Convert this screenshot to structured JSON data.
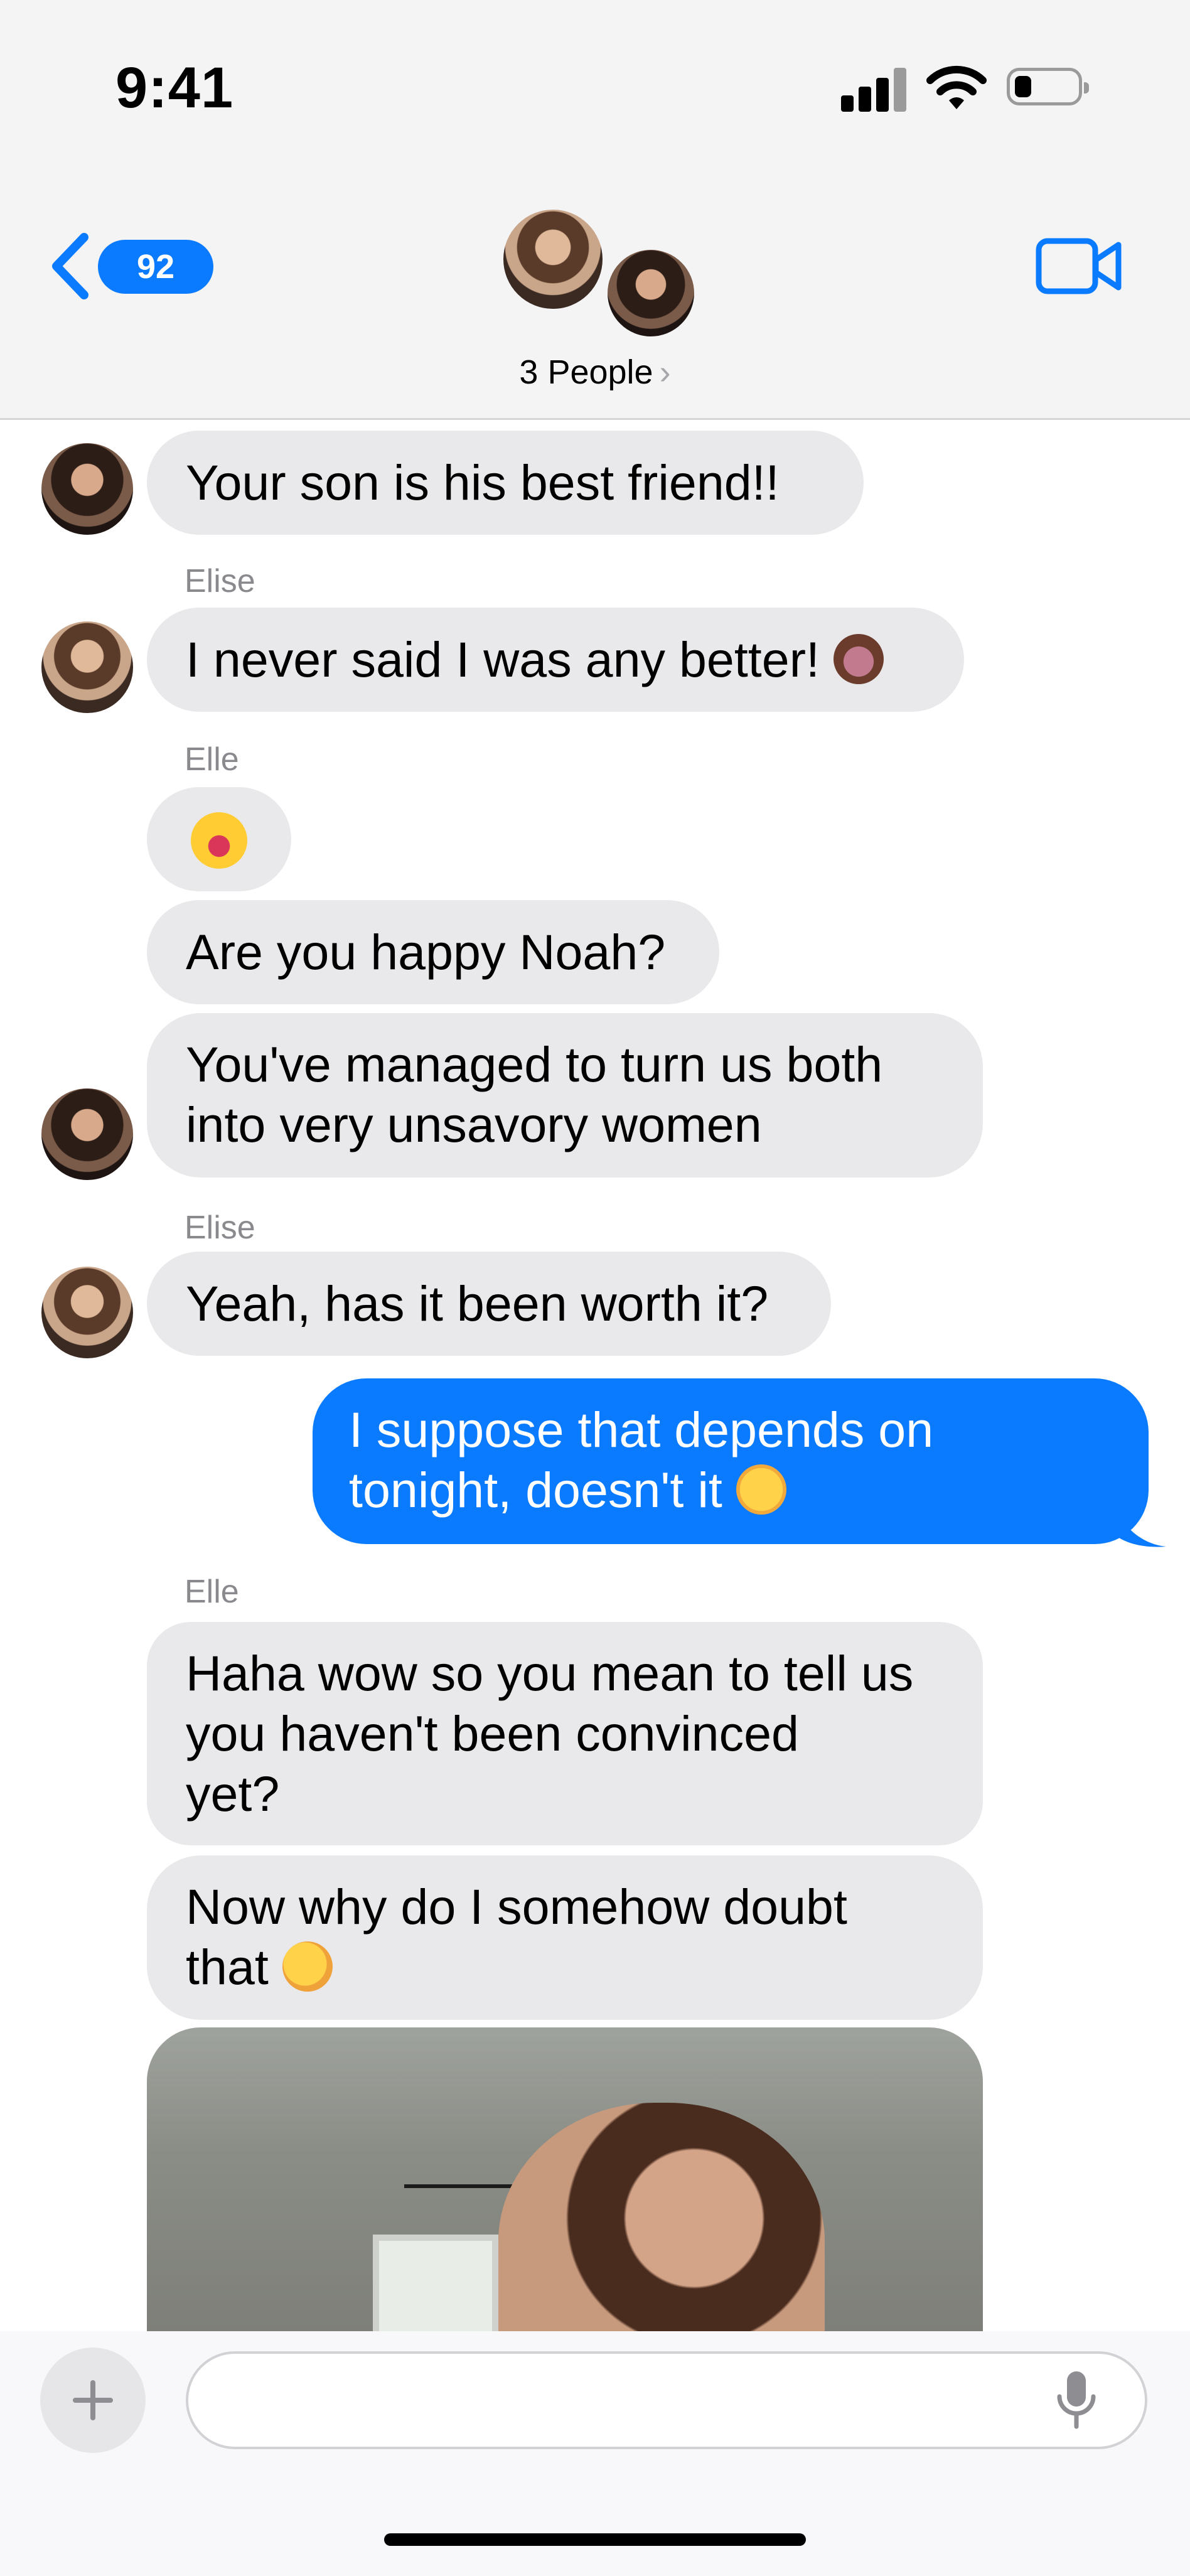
{
  "status_bar": {
    "time": "9:41"
  },
  "header": {
    "unread_count": "92",
    "conversation_title": "3 People",
    "chevron": "›"
  },
  "messages": [
    {
      "text": "Your son is his best friend!!"
    },
    {
      "sender": "Elise",
      "text": "I never said I was any better!"
    },
    {
      "sender": "Elle",
      "text": ""
    },
    {
      "text": "Are you happy Noah?"
    },
    {
      "line1": "You've managed to turn us both",
      "line2": "into very unsavory women"
    },
    {
      "sender": "Elise",
      "text": "Yeah, has it been worth it?"
    },
    {
      "line1": "I suppose that depends on",
      "line2": "tonight, doesn't it"
    },
    {
      "sender": "Elle",
      "line1": "Haha wow so you mean to tell us",
      "line2": "you haven't been convinced",
      "line3": "yet?"
    },
    {
      "line1": "Now why do I somehow doubt",
      "line2": "that"
    }
  ],
  "icons": {
    "back": "chevron-left-icon",
    "video": "video-camera-icon",
    "add": "plus-icon",
    "mic": "microphone-icon",
    "emoji_1": "see-no-evil-monkey-emoji",
    "emoji_2": "laughing-tears-emoji",
    "emoji_3": "relieved-face-emoji",
    "emoji_4": "face-with-raised-eyebrow-emoji"
  },
  "colors": {
    "accent": "#0A7BFF",
    "incoming_bubble": "#E9E9EB",
    "header_bg": "#F4F4F5"
  }
}
